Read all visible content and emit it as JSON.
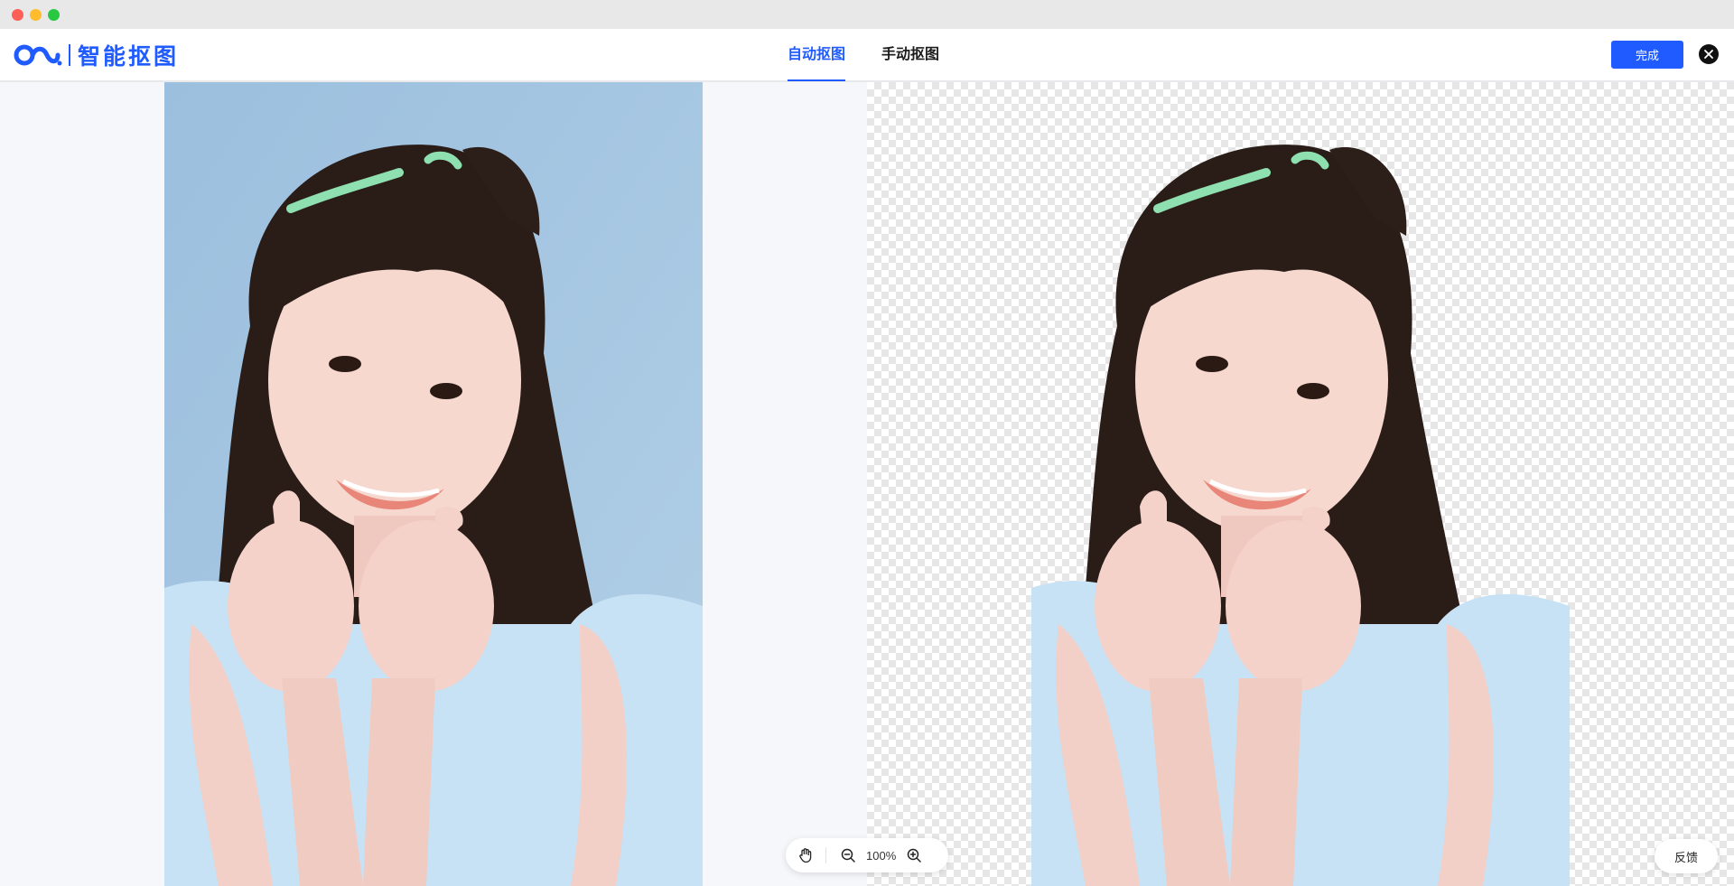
{
  "header": {
    "logo_text": "智能抠图",
    "tabs": [
      {
        "label": "自动抠图",
        "active": true
      },
      {
        "label": "手动抠图",
        "active": false
      }
    ],
    "done_label": "完成"
  },
  "toolbar": {
    "zoom_value": "100%"
  },
  "feedback_label": "反馈",
  "colors": {
    "accent": "#1f5bff",
    "original_background": "#a9c7e2",
    "workspace_background": "#f6f7fb"
  },
  "icons": [
    "logo-mark-icon",
    "close-icon",
    "hand-icon",
    "zoom-out-icon",
    "zoom-in-icon"
  ]
}
